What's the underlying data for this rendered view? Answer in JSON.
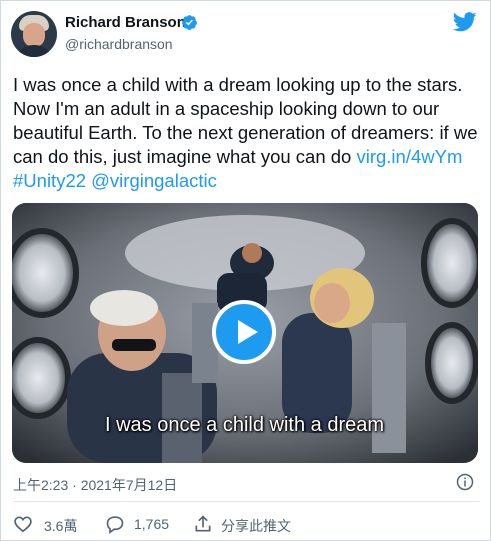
{
  "author": {
    "name": "Richard Branson",
    "handle": "@richardbranson"
  },
  "tweet": {
    "text": "I was once a child with a dream looking up to the stars. Now I'm an adult in a spaceship looking down to our beautiful Earth. To the next generation of dreamers: if we can do this, just imagine what you can do",
    "link": "virg.in/4wYm",
    "hashtag": "#Unity22",
    "mention": "@virgingalactic",
    "timestamp": "上午2:23 · 2021年7月12日"
  },
  "media": {
    "caption": "I was once a child with a dream"
  },
  "actions": {
    "likes": "3.6萬",
    "replies": "1,765",
    "share_label": "分享此推文"
  },
  "colors": {
    "accent": "#1d9bf0",
    "text": "#0f1419",
    "secondary": "#536471"
  },
  "icons": {
    "verified": "verified-badge-icon",
    "brand": "twitter-bird-icon",
    "play": "play-icon",
    "info": "info-icon",
    "like": "heart-icon",
    "reply": "reply-bubble-icon",
    "share": "share-icon"
  }
}
